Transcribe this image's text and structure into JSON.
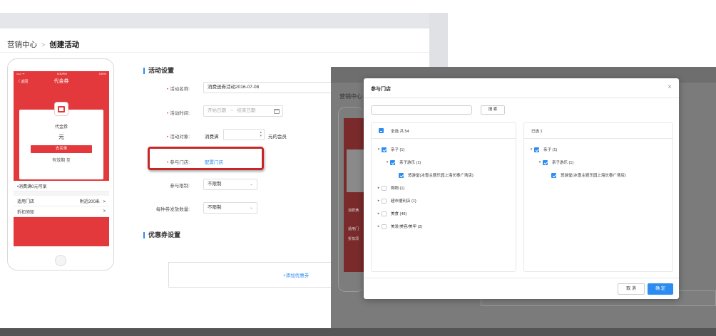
{
  "breadcrumb": {
    "root": "营销中心",
    "separator": ">",
    "current": "创建活动"
  },
  "phone": {
    "status_left": "••••• ᯤ",
    "status_time": "5:40PM",
    "status_right": "100%",
    "back_label": "〈 返回",
    "nav_title": "代金券",
    "card_name": "代金券",
    "card_unit": "元",
    "buy_button": "去买单",
    "valid_text": "有效期 至",
    "condition_text": "•消费满0元可享",
    "store_label": "适用门店",
    "store_distance": "附近200米",
    "store_chevron": ">",
    "notice_label": "折扣须知",
    "notice_chevron": ">"
  },
  "form": {
    "section_activity": "活动设置",
    "name_label": "活动名称:",
    "name_value": "消费送券活动2016-07-08",
    "time_label": "活动时间:",
    "start_placeholder": "开始日期",
    "range_sep": "~",
    "end_placeholder": "结束日期",
    "target_label": "活动对象:",
    "target_prefix": "消费满",
    "target_suffix": "元的会员",
    "store_label": "参与门店:",
    "store_link": "配置门店",
    "limit_label": "参与限制:",
    "limit_value": "不限制",
    "per_coupon_label": "每种券发放数量:",
    "per_coupon_value": "不限制",
    "section_coupon": "优惠券设置",
    "add_coupon": "+添加优惠券"
  },
  "overlay_bg": {
    "crumb": "营销中心",
    "left_texts": [
      "消费满",
      "适用门",
      "折扣须"
    ]
  },
  "modal": {
    "title": "参与门店",
    "close": "×",
    "search_placeholder": "",
    "search_button": "搜 索",
    "left_header": "全选  共 54",
    "right_header": "已选 1",
    "left_tree": [
      {
        "label": "亲子 (1)",
        "expanded": true,
        "state": "on",
        "level": 0
      },
      {
        "label": "亲子游乐 (1)",
        "expanded": true,
        "state": "on",
        "level": 1
      },
      {
        "label": "悠游堂(冰雪主题乐园上海长泰广场店)",
        "expanded": false,
        "state": "on",
        "level": 2
      },
      {
        "label": "购物 (1)",
        "expanded": false,
        "state": "off",
        "level": 0
      },
      {
        "label": "超市便利店 (1)",
        "expanded": false,
        "state": "off",
        "level": 0
      },
      {
        "label": "美食 (49)",
        "expanded": false,
        "state": "off",
        "level": 0
      },
      {
        "label": "美发/美容/美甲 (2)",
        "expanded": false,
        "state": "off",
        "level": 0
      }
    ],
    "right_tree": [
      {
        "label": "亲子 (1)",
        "expanded": true,
        "state": "on",
        "level": 0
      },
      {
        "label": "亲子游乐 (1)",
        "expanded": true,
        "state": "on",
        "level": 1
      },
      {
        "label": "悠游堂(冰雪主题乐园上海长泰广场店)",
        "expanded": false,
        "state": "on",
        "level": 2
      }
    ],
    "cancel_button": "取 消",
    "ok_button": "确 定"
  }
}
